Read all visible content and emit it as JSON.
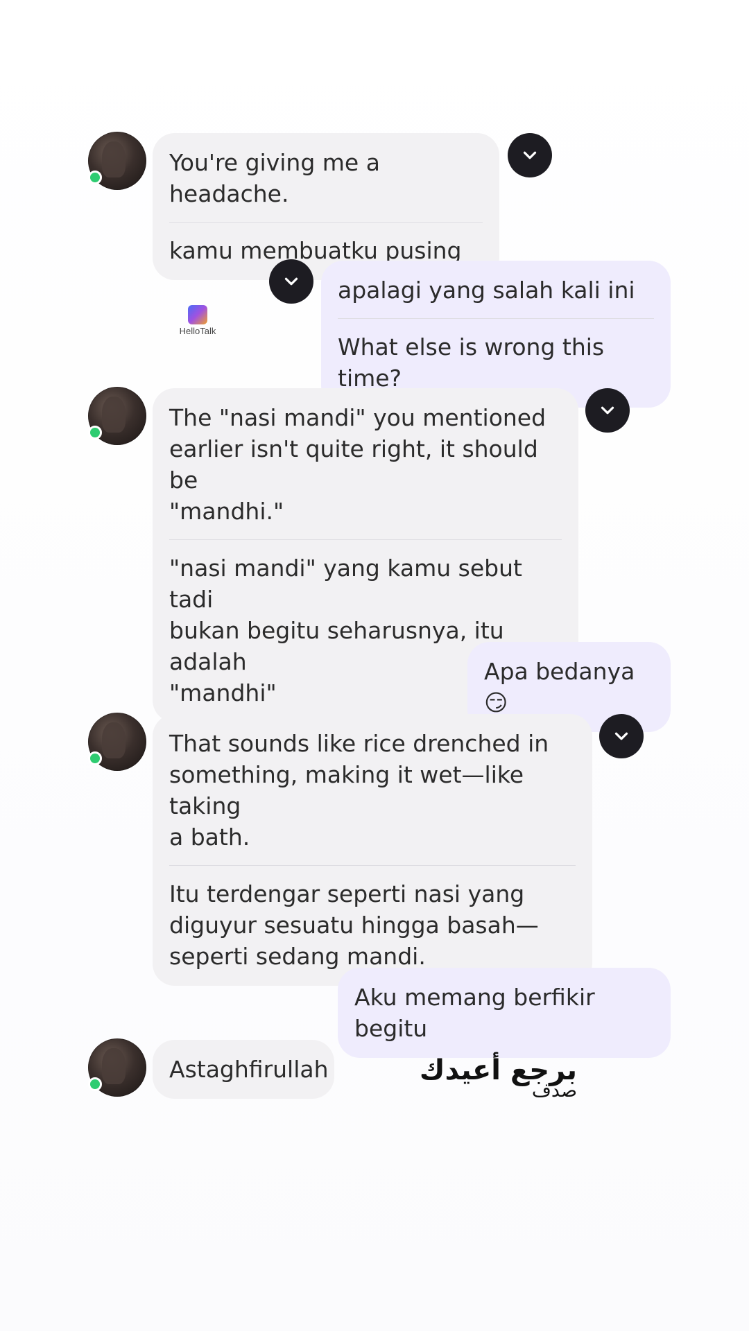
{
  "watermark": {
    "logo_text": "HelloTalk"
  },
  "messages": [
    {
      "direction": "incoming",
      "original": "You're giving me a headache.",
      "translation": "kamu membuatku pusing"
    },
    {
      "direction": "outgoing",
      "original": "apalagi yang salah kali ini",
      "translation": "What else is wrong this time?"
    },
    {
      "direction": "incoming",
      "original": "The \"nasi mandi\" you mentioned\nearlier isn't quite right, it should be\n\"mandhi.\"",
      "translation": "\"nasi mandi\" yang kamu sebut tadi\nbukan begitu seharusnya, itu adalah\n\"mandhi\""
    },
    {
      "direction": "outgoing",
      "original": "Apa bedanya😏"
    },
    {
      "direction": "incoming",
      "original": "That sounds like rice drenched in\nsomething, making it wet—like taking\na bath.",
      "translation": "Itu terdengar seperti nasi yang\ndiguyur sesuatu hingga basah—\nseperti sedang mandi."
    },
    {
      "direction": "outgoing",
      "original": "Aku memang berfikir begitu"
    },
    {
      "direction": "incoming",
      "original": "Astaghfirullah"
    }
  ],
  "overlay": {
    "main": "برجع أعيدك",
    "sub": "صدف"
  },
  "icons": {
    "translate_toggle": "chevron-down-icon",
    "status": "online-status-dot"
  },
  "colors": {
    "incoming_bubble": "#f2f1f3",
    "outgoing_bubble": "#efecfd",
    "translate_button": "#1d1c22",
    "online": "#2ecc71"
  }
}
